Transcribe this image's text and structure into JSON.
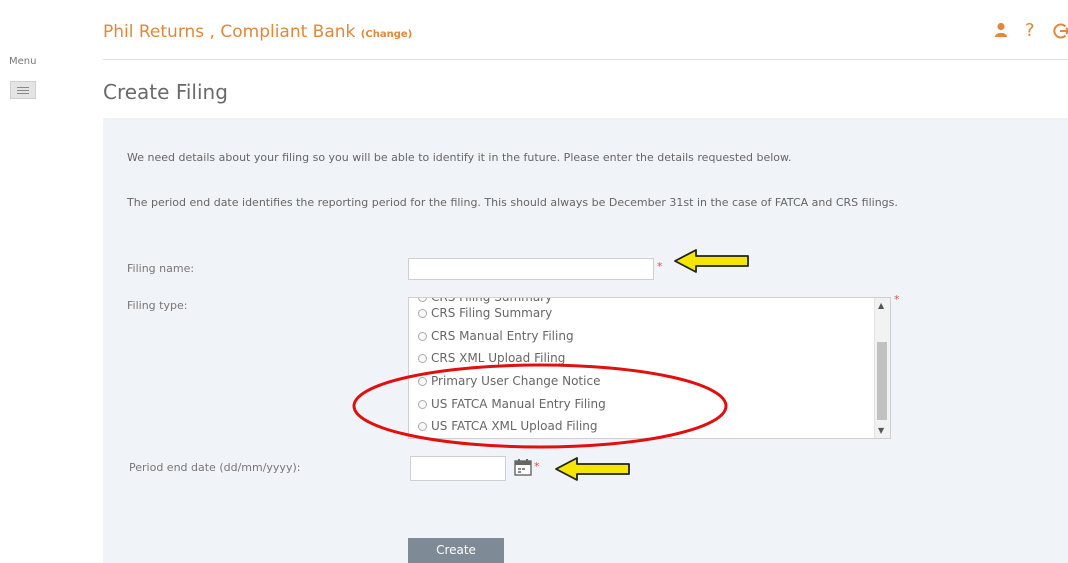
{
  "menu": {
    "label": "Menu"
  },
  "header": {
    "title": "Phil Returns , Compliant Bank",
    "change_link": "(Change)",
    "help_glyph": "?",
    "icons": [
      "user-icon",
      "help-icon",
      "logout-icon"
    ]
  },
  "page": {
    "title": "Create Filing"
  },
  "form": {
    "intro": "We need details about your filing so you will be able to identify it in the future. Please enter the details requested below.",
    "description": "The period end date identifies the reporting period for the filing. This should always be December 31st in the case of FATCA and CRS filings.",
    "required_marker": "*",
    "filing_name": {
      "label": "Filing name:",
      "value": ""
    },
    "filing_type": {
      "label": "Filing type:",
      "options": [
        "CRS Filing Summary",
        "CRS Manual Entry Filing",
        "CRS XML Upload Filing",
        "Primary User Change Notice",
        "US FATCA Manual Entry Filing",
        "US FATCA XML Upload Filing"
      ]
    },
    "period_end_date": {
      "label": "Period end date (dd/mm/yyyy):",
      "value": ""
    },
    "create_button": "Create"
  },
  "colors": {
    "accent": "#e0883c",
    "panel_bg": "#f0f3f7",
    "button_bg": "#7e8a96",
    "annotation_arrow": "#f5e600",
    "annotation_ellipse": "#e01010",
    "required": "#e05050"
  }
}
